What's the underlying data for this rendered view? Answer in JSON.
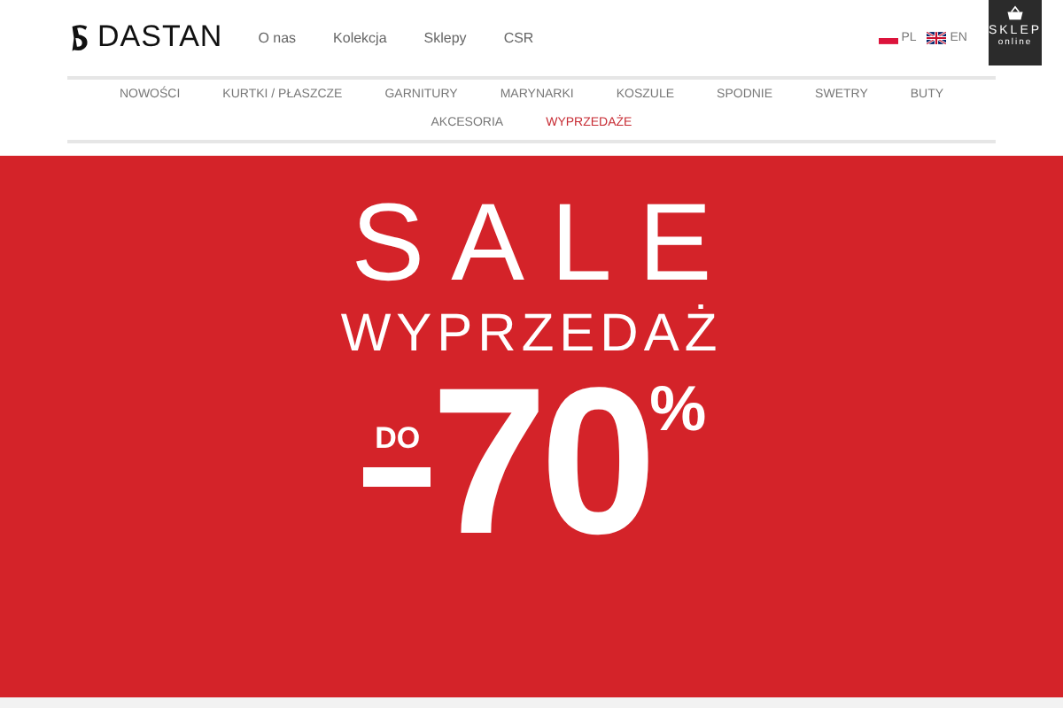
{
  "header": {
    "logo": "DASTAN",
    "links": [
      "O nas",
      "Kolekcja",
      "Sklepy",
      "CSR"
    ],
    "languages": [
      {
        "code": "PL",
        "kind": "pl"
      },
      {
        "code": "EN",
        "kind": "gb"
      }
    ],
    "shop_button": {
      "title": "SKLEP",
      "subtitle": "online"
    }
  },
  "categories": [
    {
      "label": "NOWOŚCI",
      "selected": false
    },
    {
      "label": "KURTKI / PŁASZCZE",
      "selected": false
    },
    {
      "label": "GARNITURY",
      "selected": false
    },
    {
      "label": "MARYNARKI",
      "selected": false
    },
    {
      "label": "KOSZULE",
      "selected": false
    },
    {
      "label": "SPODNIE",
      "selected": false
    },
    {
      "label": "SWETRY",
      "selected": false
    },
    {
      "label": "BUTY",
      "selected": false
    },
    {
      "label": "AKCESORIA",
      "selected": false
    },
    {
      "label": "WYPRZEDAŻE",
      "selected": true
    }
  ],
  "banner": {
    "title": "SALE",
    "subtitle": "WYPRZEDAŻ",
    "prefix": "DO",
    "amount": "70",
    "unit": "%"
  }
}
